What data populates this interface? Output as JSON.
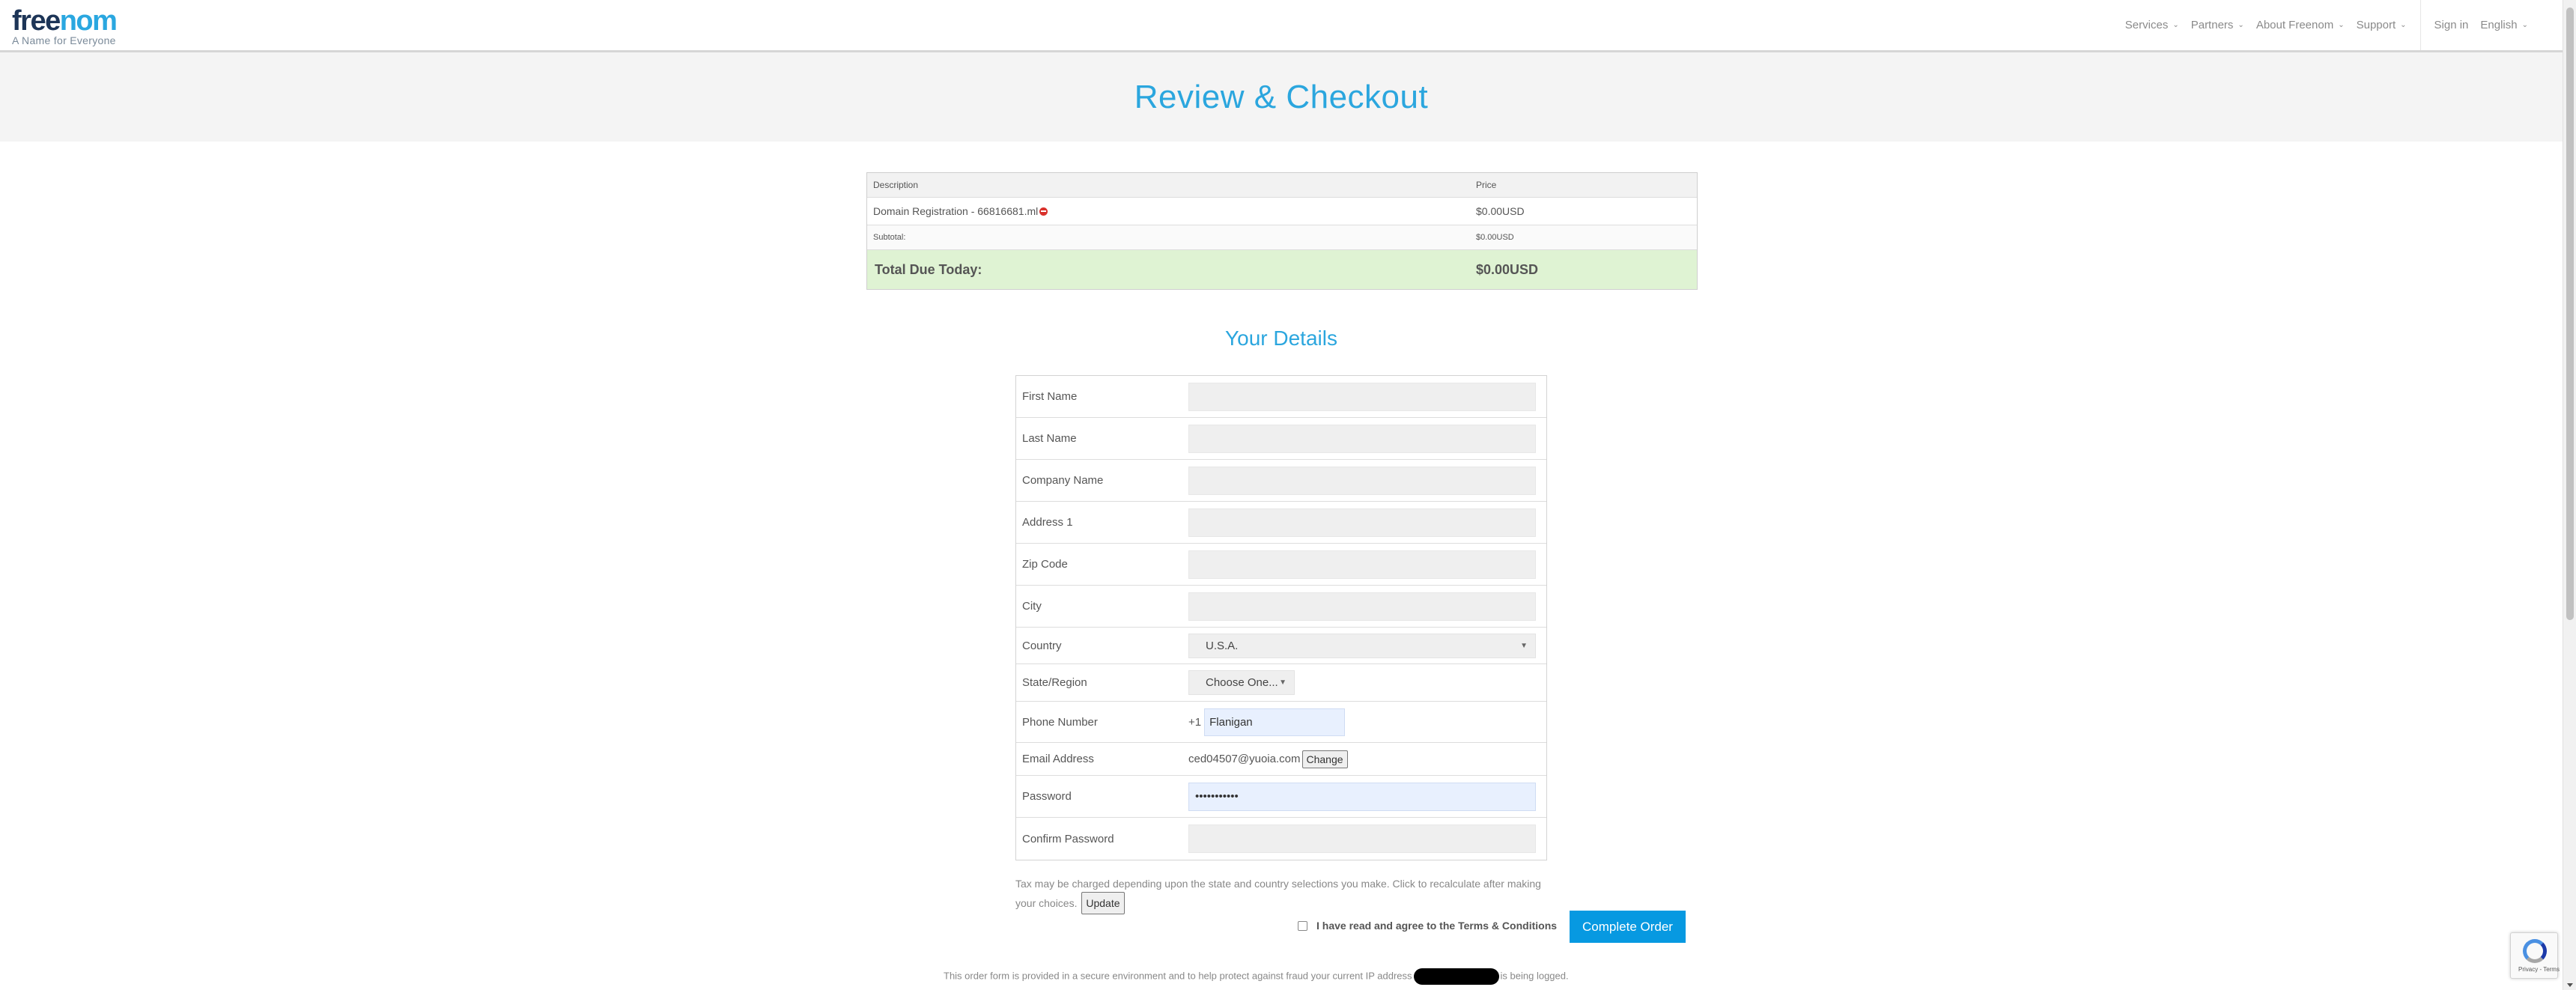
{
  "header": {
    "logo_part1": "free",
    "logo_part2": "nom",
    "tagline": "A Name for Everyone",
    "nav": [
      {
        "label": "Services"
      },
      {
        "label": "Partners"
      },
      {
        "label": "About Freenom"
      },
      {
        "label": "Support"
      }
    ],
    "sign_in": "Sign in",
    "language": "English"
  },
  "page_title": "Review & Checkout",
  "cart": {
    "col_description": "Description",
    "col_price": "Price",
    "item_description": "Domain Registration - 66816681.ml",
    "item_price": "$0.00USD",
    "subtotal_label": "Subtotal:",
    "subtotal_value": "$0.00USD",
    "total_label": "Total Due Today:",
    "total_value": "$0.00USD"
  },
  "details": {
    "title": "Your Details",
    "first_name_label": "First Name",
    "first_name_value": "",
    "last_name_label": "Last Name",
    "last_name_value": "",
    "company_label": "Company Name",
    "company_value": "",
    "address_label": "Address 1",
    "address_value": "",
    "zip_label": "Zip Code",
    "zip_value": "",
    "city_label": "City",
    "city_value": "",
    "country_label": "Country",
    "country_value": "U.S.A.",
    "state_label": "State/Region",
    "state_value": "Choose One...",
    "phone_label": "Phone Number",
    "phone_prefix": "+1",
    "phone_value": "Flanigan",
    "email_label": "Email Address",
    "email_value": "ced04507@yuoia.com",
    "email_change": "Change",
    "password_label": "Password",
    "password_value": "•••••••••••",
    "confirm_label": "Confirm Password",
    "confirm_value": ""
  },
  "tax_note": "Tax may be charged depending upon the state and country selections you make. Click to recalculate after making your choices.",
  "update_button": "Update",
  "agree_prefix": "I have read and agree to the ",
  "agree_link": "Terms & Conditions",
  "complete_button": "Complete Order",
  "footnote_before": "This order form is provided in a secure environment and to help protect against fraud your current IP address",
  "footnote_after": "is being logged.",
  "recaptcha_text": "Privacy - Terms"
}
